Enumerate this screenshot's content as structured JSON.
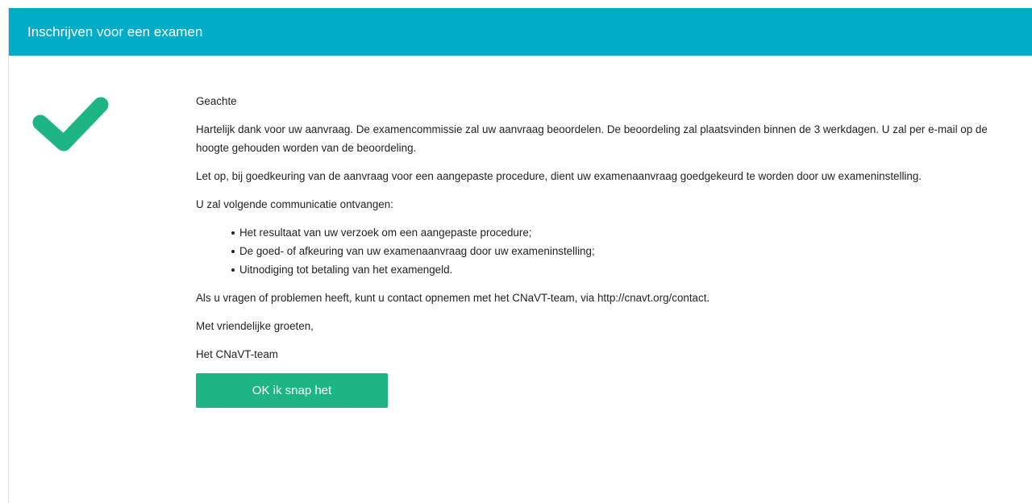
{
  "header": {
    "title": "Inschrijven voor een examen"
  },
  "icon": {
    "name": "checkmark-icon",
    "color": "#1db584"
  },
  "colors": {
    "header_bg": "#00acc8",
    "button_bg": "#1db584"
  },
  "message": {
    "salutation": "Geachte",
    "para1": "Hartelijk dank voor uw aanvraag. De examencommissie zal uw aanvraag beoordelen. De beoordeling zal plaatsvinden binnen de 3 werkdagen. U zal per e-mail op de hoogte gehouden worden van de beoordeling.",
    "para2": "Let op, bij goedkeuring van de aanvraag voor een aangepaste procedure, dient uw examenaanvraag goedgekeurd te worden door uw exameninstelling.",
    "para3": "U zal volgende communicatie ontvangen:",
    "bullets": [
      "Het resultaat van uw verzoek om een aangepaste procedure;",
      "De goed- of afkeuring van uw examenaanvraag door uw exameninstelling;",
      "Uitnodiging tot betaling van het examengeld."
    ],
    "para4": "Als u vragen of problemen heeft, kunt u contact opnemen met het CNaVT-team, via http://cnavt.org/contact.",
    "closing": "Met vriendelijke groeten,",
    "signature": "Het CNaVT-team"
  },
  "button": {
    "ok_label": "OK ik snap het"
  }
}
